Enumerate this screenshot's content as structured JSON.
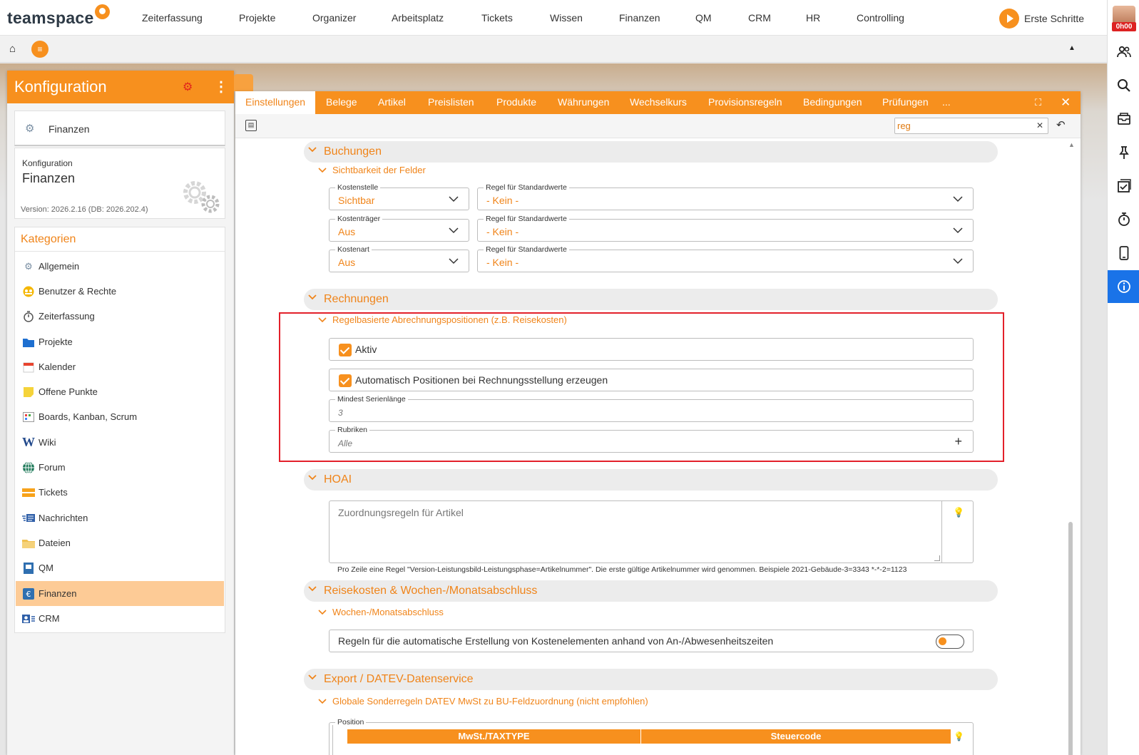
{
  "app": {
    "logo_text": "teamspace",
    "nav": [
      "Zeiterfassung",
      "Projekte",
      "Organizer",
      "Arbeitsplatz",
      "Tickets",
      "Wissen",
      "Finanzen",
      "QM",
      "CRM",
      "HR",
      "Controlling"
    ],
    "erste_schritte": "Erste Schritte",
    "timer_badge": "0h00"
  },
  "rightbar": {
    "icons": [
      "users-icon",
      "search-icon",
      "inbox-icon",
      "pin-icon",
      "checklist-icon",
      "stopwatch-icon",
      "mobile-icon",
      "info-icon"
    ]
  },
  "left": {
    "title": "Konfiguration",
    "module": "Finanzen",
    "cfg_small": "Konfiguration",
    "cfg_big": "Finanzen",
    "version": "Version: 2026.2.16 (DB: 2026.202.4)",
    "categories_title": "Kategorien",
    "categories": [
      {
        "label": "Allgemein",
        "icon": "gears-icon"
      },
      {
        "label": "Benutzer & Rechte",
        "icon": "users-badge-icon"
      },
      {
        "label": "Zeiterfassung",
        "icon": "stopwatch-icon"
      },
      {
        "label": "Projekte",
        "icon": "folder-icon"
      },
      {
        "label": "Kalender",
        "icon": "calendar-icon"
      },
      {
        "label": "Offene Punkte",
        "icon": "sticky-note-icon"
      },
      {
        "label": "Boards, Kanban, Scrum",
        "icon": "board-icon"
      },
      {
        "label": "Wiki",
        "icon": "wiki-icon"
      },
      {
        "label": "Forum",
        "icon": "globe-icon"
      },
      {
        "label": "Tickets",
        "icon": "ticket-icon"
      },
      {
        "label": "Nachrichten",
        "icon": "messages-icon"
      },
      {
        "label": "Dateien",
        "icon": "files-icon"
      },
      {
        "label": "QM",
        "icon": "qm-icon"
      },
      {
        "label": "Finanzen",
        "icon": "euro-icon"
      },
      {
        "label": "CRM",
        "icon": "contact-card-icon"
      }
    ],
    "selected": "Finanzen"
  },
  "tabs": [
    "Einstellungen",
    "Belege",
    "Artikel",
    "Preislisten",
    "Produkte",
    "Währungen",
    "Wechselkurs",
    "Provisionsregeln",
    "Bedingungen",
    "Prüfungen",
    "..."
  ],
  "active_tab": "Einstellungen",
  "search": {
    "value": "reg"
  },
  "sections": {
    "buchungen": {
      "title": "Buchungen",
      "sub": "Sichtbarkeit der Felder",
      "rows": [
        {
          "label": "Kostenstelle",
          "value": "Sichtbar",
          "rule_label": "Regel für Standardwerte",
          "rule_value": "- Kein -"
        },
        {
          "label": "Kostenträger",
          "value": "Aus",
          "rule_label": "Regel für Standardwerte",
          "rule_value": "- Kein -"
        },
        {
          "label": "Kostenart",
          "value": "Aus",
          "rule_label": "Regel für Standardwerte",
          "rule_value": "- Kein -"
        }
      ]
    },
    "rechnungen": {
      "title": "Rechnungen",
      "sub": "Regelbasierte Abrechnungspositionen (z.B. Reisekosten)",
      "aktiv": "Aktiv",
      "auto": "Automatisch Positionen bei Rechnungsstellung erzeugen",
      "mindest_label": "Mindest Serienlänge",
      "mindest_value": "3",
      "rubriken_label": "Rubriken",
      "rubriken_value": "Alle"
    },
    "hoai": {
      "title": "HOAI",
      "placeholder": "Zuordnungsregeln für Artikel",
      "hint": "Pro Zeile eine Regel \"Version-Leistungsbild-Leistungsphase=Artikelnummer\". Die erste gültige Artikelnummer wird genommen. Beispiele 2021-Gebäude-3=3343 *-*-2=1123"
    },
    "reisekosten": {
      "title": "Reisekosten & Wochen-/Monatsabschluss",
      "sub": "Wochen-/Monatsabschluss",
      "toggle_label": "Regeln für die automatische Erstellung von Kostenelementen anhand von An-/Abwesenheitszeiten"
    },
    "export": {
      "title": "Export / DATEV-Datenservice",
      "sub": "Globale Sonderregeln DATEV MwSt zu BU-Feldzuordnung (nicht empfohlen)",
      "table_label": "Position",
      "columns": [
        "MwSt./TAXTYPE",
        "Steuercode"
      ]
    }
  },
  "colors": {
    "accent": "#f7901e",
    "accent_text": "#f08419",
    "highlight": "#e3202a",
    "info": "#1a73e8"
  }
}
